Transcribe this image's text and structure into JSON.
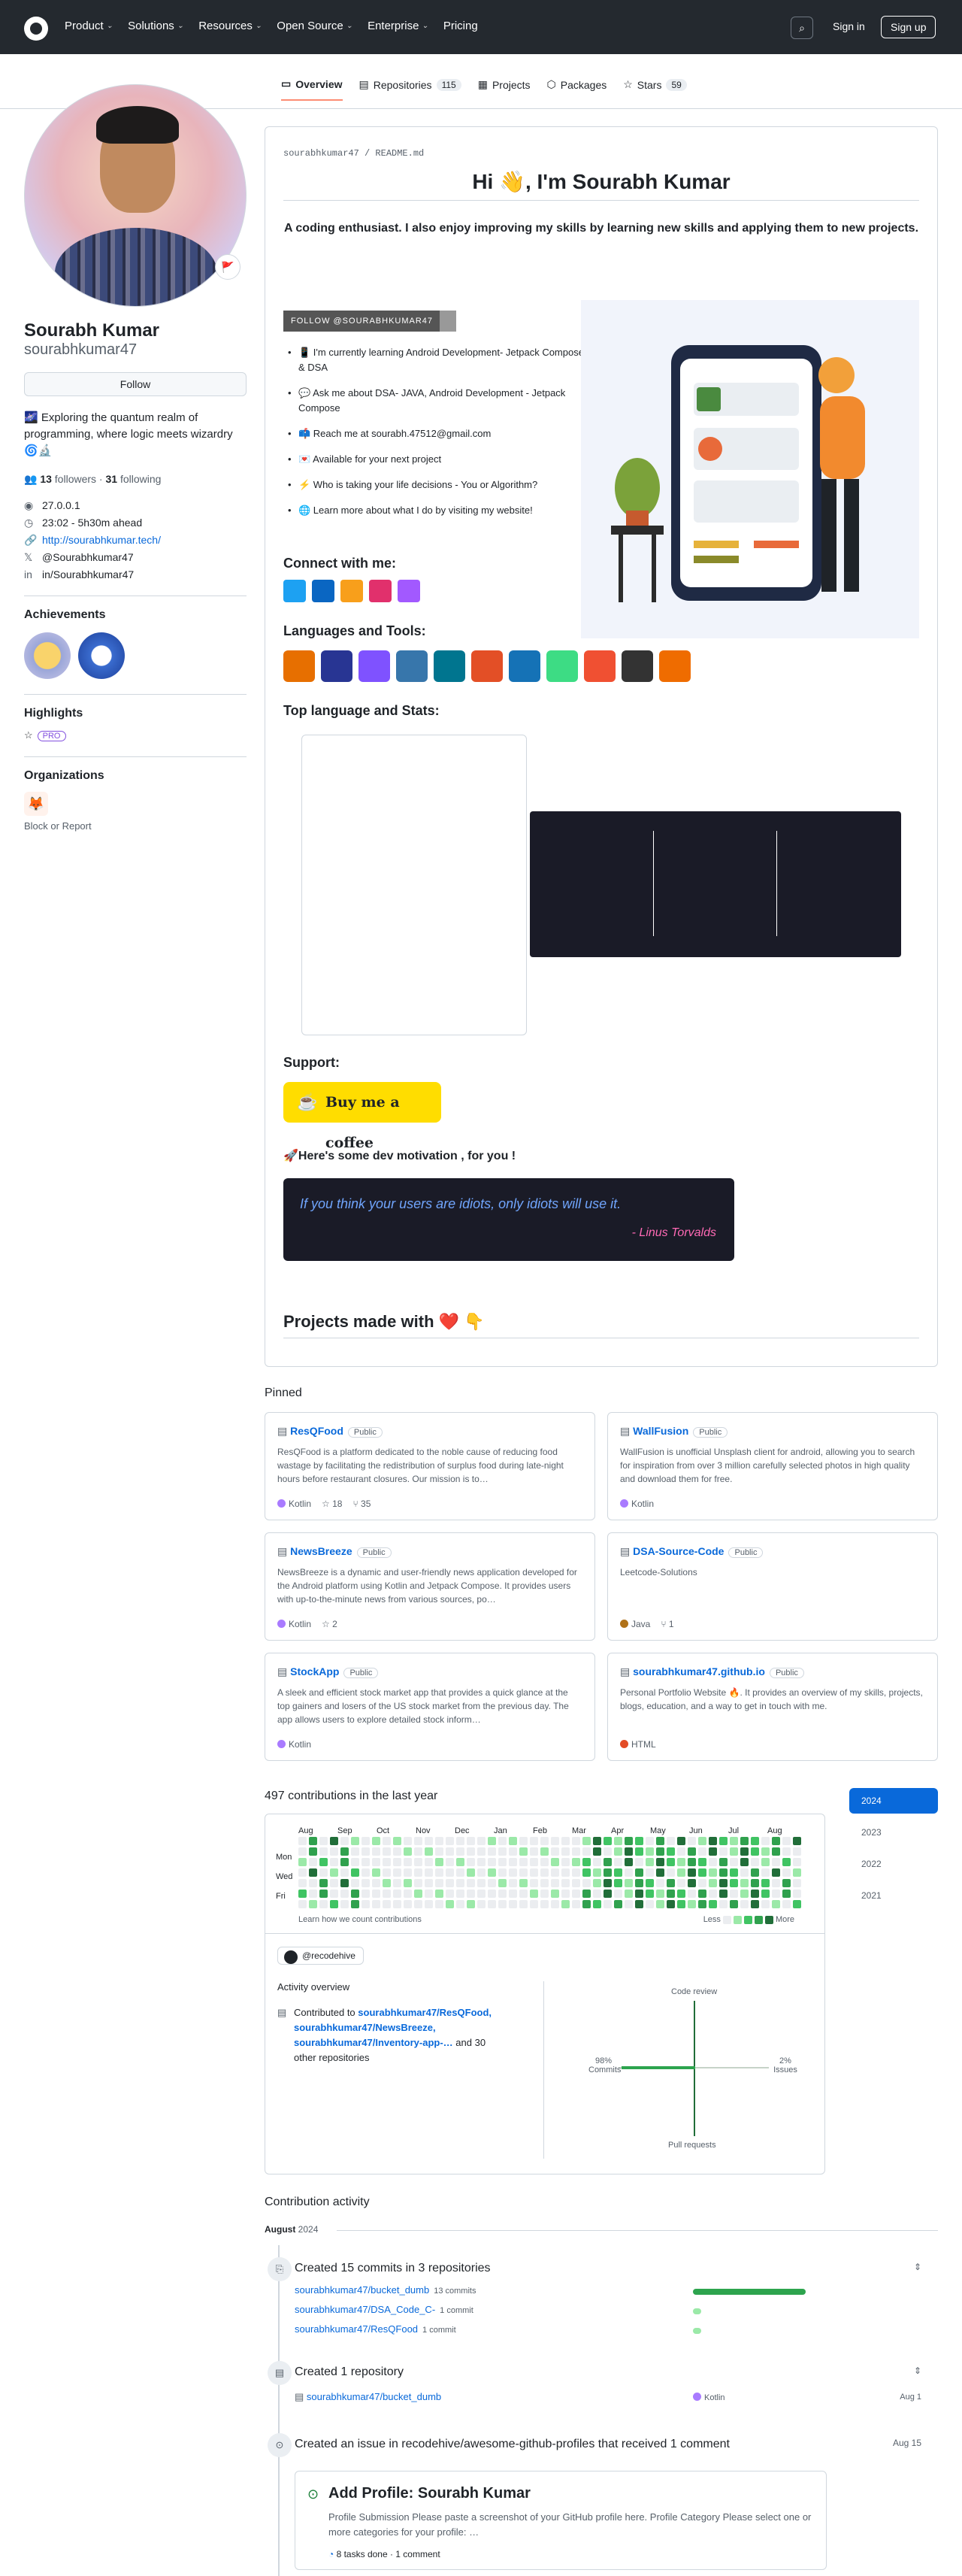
{
  "header": {
    "nav": [
      "Product",
      "Solutions",
      "Resources",
      "Open Source",
      "Enterprise",
      "Pricing"
    ],
    "signin": "Sign in",
    "signup": "Sign up"
  },
  "tabs": [
    {
      "label": "Overview"
    },
    {
      "label": "Repositories",
      "count": "115"
    },
    {
      "label": "Projects"
    },
    {
      "label": "Packages"
    },
    {
      "label": "Stars",
      "count": "59"
    }
  ],
  "profile": {
    "name": "Sourabh Kumar",
    "login": "sourabhkumar47",
    "follow": "Follow",
    "bio": "🌌 Exploring the quantum realm of programming, where logic meets wizardry 🌀🔬",
    "followers": "13",
    "followers_label": "followers",
    "following": "31",
    "following_label": "following",
    "meta": [
      "27.0.0.1",
      "23:02 - 5h30m ahead",
      "http://sourabhkumar.tech/",
      "@Sourabhkumar47",
      "in/Sourabhkumar47"
    ]
  },
  "sidebar": {
    "achievements": "Achievements",
    "highlights": "Highlights",
    "pro": "PRO",
    "organizations": "Organizations",
    "block": "Block or Report"
  },
  "readme": {
    "path": "sourabhkumar47 / README.md",
    "title": "Hi 👋, I'm Sourabh Kumar",
    "lead": "A coding enthusiast. I also enjoy improving my skills by learning new skills and applying them to new projects.",
    "follow_badge": "FOLLOW @SOURABHKUMAR47",
    "items": [
      "📱 I'm currently learning Android Development- Jetpack Compose & DSA",
      "💬 Ask me about DSA- JAVA, Android Development - Jetpack Compose",
      "📫 Reach me at sourabh.47512@gmail.com",
      "💌 Available for your next project",
      "⚡ Who is taking your life decisions - You or Algorithm?",
      "🌐 Learn more about what I do by visiting my website!"
    ],
    "connect": "Connect with me:",
    "tools": "Languages and Tools:",
    "stats": "Top language and Stats:",
    "support": "Support:",
    "coffee": "Buy me a coffee",
    "motivation": "🚀Here's some dev motivation , for you !",
    "quote": "If you think your users are idiots, only idiots will use it.",
    "quote_author": "- Linus Torvalds",
    "projects": "Projects made with ❤️ 👇"
  },
  "pinned": {
    "heading": "Pinned",
    "public": "Public",
    "repos": [
      {
        "name": "ResQFood",
        "desc": "ResQFood is a platform dedicated to the noble cause of reducing food wastage by facilitating the redistribution of surplus food during late-night hours before restaurant closures. Our mission is to…",
        "lang": "Kotlin",
        "color": "#a97bff",
        "stars": "18",
        "forks": "35"
      },
      {
        "name": "WallFusion",
        "desc": "WallFusion is unofficial Unsplash client for android, allowing you to search for inspiration from over 3 million carefully selected photos in high quality and download them for free.",
        "lang": "Kotlin",
        "color": "#a97bff",
        "stars": "",
        "forks": ""
      },
      {
        "name": "NewsBreeze",
        "desc": "NewsBreeze is a dynamic and user-friendly news application developed for the Android platform using Kotlin and Jetpack Compose. It provides users with up-to-the-minute news from various sources, po…",
        "lang": "Kotlin",
        "color": "#a97bff",
        "stars": "2",
        "forks": ""
      },
      {
        "name": "DSA-Source-Code",
        "desc": "Leetcode-Solutions",
        "lang": "Java",
        "color": "#b07219",
        "stars": "",
        "forks": "1"
      },
      {
        "name": "StockApp",
        "desc": "A sleek and efficient stock market app that provides a quick glance at the top gainers and losers of the US stock market from the previous day. The app allows users to explore detailed stock inform…",
        "lang": "Kotlin",
        "color": "#a97bff",
        "stars": "",
        "forks": ""
      },
      {
        "name": "sourabhkumar47.github.io",
        "desc": "Personal Portfolio Website 🔥. It provides an overview of my skills, projects, blogs, education, and a way to get in touch with me.",
        "lang": "HTML",
        "color": "#e34c26",
        "stars": "",
        "forks": ""
      }
    ]
  },
  "contributions": {
    "heading": "497 contributions in the last year",
    "months": [
      "Aug",
      "Sep",
      "Oct",
      "Nov",
      "Dec",
      "Jan",
      "Feb",
      "Mar",
      "Apr",
      "May",
      "Jun",
      "Jul",
      "Aug"
    ],
    "days": [
      "Mon",
      "Wed",
      "Fri"
    ],
    "learn": "Learn how we count contributions",
    "less": "Less",
    "more": "More",
    "years": [
      "2024",
      "2023",
      "2022",
      "2021"
    ],
    "org": "@recodehive",
    "overview": "Activity overview",
    "contrib_prefix": "Contributed to",
    "contrib_repos": "sourabhkumar47/ResQFood, sourabhkumar47/NewsBreeze, sourabhkumar47/Inventory-app-…",
    "contrib_suffix": "and 30 other repositories",
    "radar": {
      "top": "Code review",
      "left_pct": "98%",
      "left": "Commits",
      "right_pct": "2%",
      "right": "Issues",
      "bottom": "Pull requests"
    }
  },
  "activity": {
    "heading": "Contribution activity",
    "month": "August",
    "year": "2024",
    "commits": {
      "title": "Created 15 commits in 3 repositories",
      "repos": [
        {
          "name": "sourabhkumar47/bucket_dumb",
          "count": "13 commits",
          "frac": 1
        },
        {
          "name": "sourabhkumar47/DSA_Code_C-",
          "count": "1 commit",
          "frac": 0.07
        },
        {
          "name": "sourabhkumar47/ResQFood",
          "count": "1 commit",
          "frac": 0.07
        }
      ]
    },
    "repo": {
      "title": "Created 1 repository",
      "name": "sourabhkumar47/bucket_dumb",
      "lang": "Kotlin",
      "date": "Aug 1"
    },
    "issue": {
      "title": "Created an issue in recodehive/awesome-github-profiles that received 1 comment",
      "date": "Aug 15",
      "card_title": "Add Profile: Sourabh Kumar",
      "card_desc": "Profile Submission Please paste a screenshot of your GitHub profile here. Profile Category Please select one or more categories for your profile: …",
      "card_foot": "8 tasks done · 1 comment"
    }
  }
}
